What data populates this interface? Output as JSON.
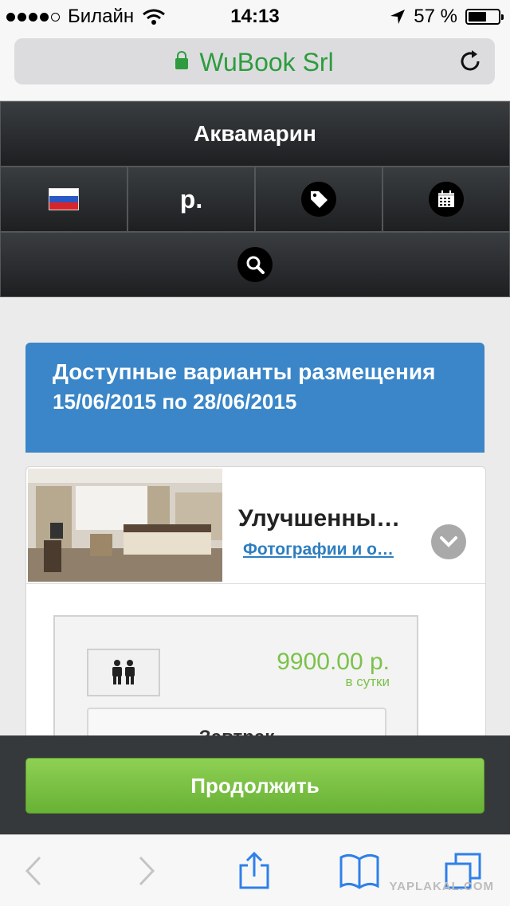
{
  "status_bar": {
    "carrier": "Билайн",
    "time": "14:13",
    "battery": "57 %"
  },
  "browser": {
    "url_title": "WuBook Srl"
  },
  "header": {
    "hotel_name": "Аквамарин",
    "currency_symbol": "р."
  },
  "results": {
    "title": "Доступные варианты размещения",
    "dates": "15/06/2015 по 28/06/2015"
  },
  "room": {
    "name": "Улучшенны…",
    "photos_link": "Фотографии и о…",
    "price": "9900.00 р.",
    "price_unit": "в сутки",
    "board": "Завтрак"
  },
  "actions": {
    "continue_label": "Продолжить"
  },
  "watermark": "YAPLAKAL.COM",
  "colors": {
    "accent_blue": "#3a86c8",
    "green_button": "#7cc24a",
    "url_green": "#2e9c3e",
    "dark_header": "#2b2e30"
  }
}
